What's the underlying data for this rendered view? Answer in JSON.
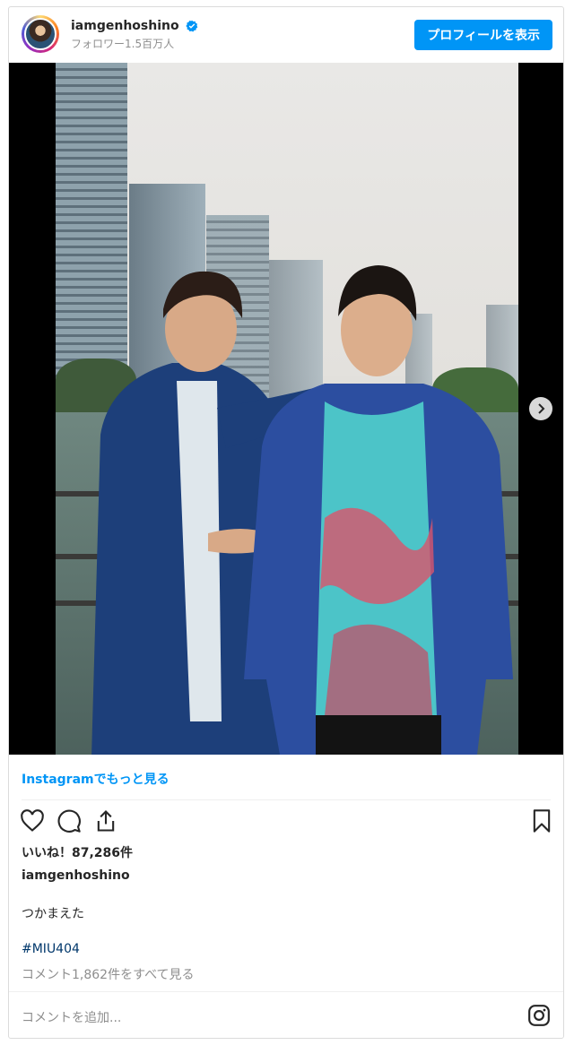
{
  "header": {
    "username": "iamgenhoshino",
    "followers": "フォロワー1.5百万人",
    "profile_button": "プロフィールを表示"
  },
  "post": {
    "carousel": {
      "total_slides": 2,
      "current_slide": 1
    },
    "more_link": "Instagramでもっと見る",
    "likes": "いいね！87,286件",
    "caption_user": "iamgenhoshino",
    "caption": "つかまえた",
    "hashtag": "#MIU404",
    "view_comments": "コメント1,862件をすべて見る",
    "comment_placeholder": "コメントを追加..."
  },
  "icons": {
    "verified": "verified-badge-icon",
    "next": "chevron-right-icon",
    "like": "heart-icon",
    "comment": "comment-bubble-icon",
    "share": "share-icon",
    "save": "bookmark-icon",
    "instagram": "instagram-logo-icon"
  },
  "colors": {
    "accent": "#0095f6",
    "link": "#00376b",
    "muted": "#8e8e8e"
  }
}
